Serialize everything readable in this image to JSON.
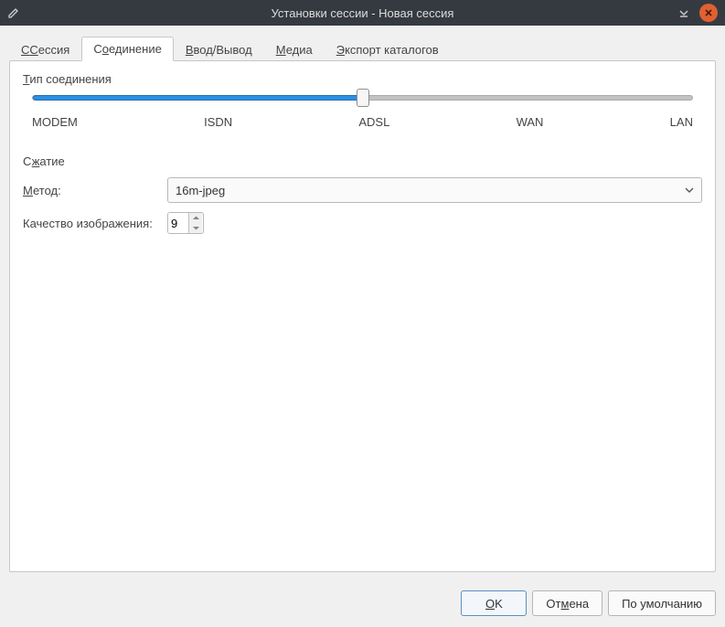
{
  "window": {
    "title": "Установки сессии - Новая сессия"
  },
  "tabs": {
    "session": "Сессия",
    "session_ul": "С",
    "connection": "Соединение",
    "connection_ul": "о",
    "io": "Ввод/Вывод",
    "io_ul": "В",
    "media": "Медиа",
    "media_ul": "М",
    "export": "Экспорт каталогов",
    "export_ul": "Э"
  },
  "connection_type": {
    "label": "Тип соединения",
    "label_ul": "Т",
    "ticks": [
      "MODEM",
      "ISDN",
      "ADSL",
      "WAN",
      "LAN"
    ],
    "value_index": 2
  },
  "compression": {
    "label": "Сжатие",
    "label_ul": "ж",
    "method_label": "Метод:",
    "method_ul": "М",
    "method_value": "16m-jpeg",
    "quality_label": "Качество изображения:",
    "quality_value": "9"
  },
  "buttons": {
    "ok": "OK",
    "ok_ul": "O",
    "cancel": "Отмена",
    "cancel_ul": "м",
    "default": "По умолчанию"
  }
}
